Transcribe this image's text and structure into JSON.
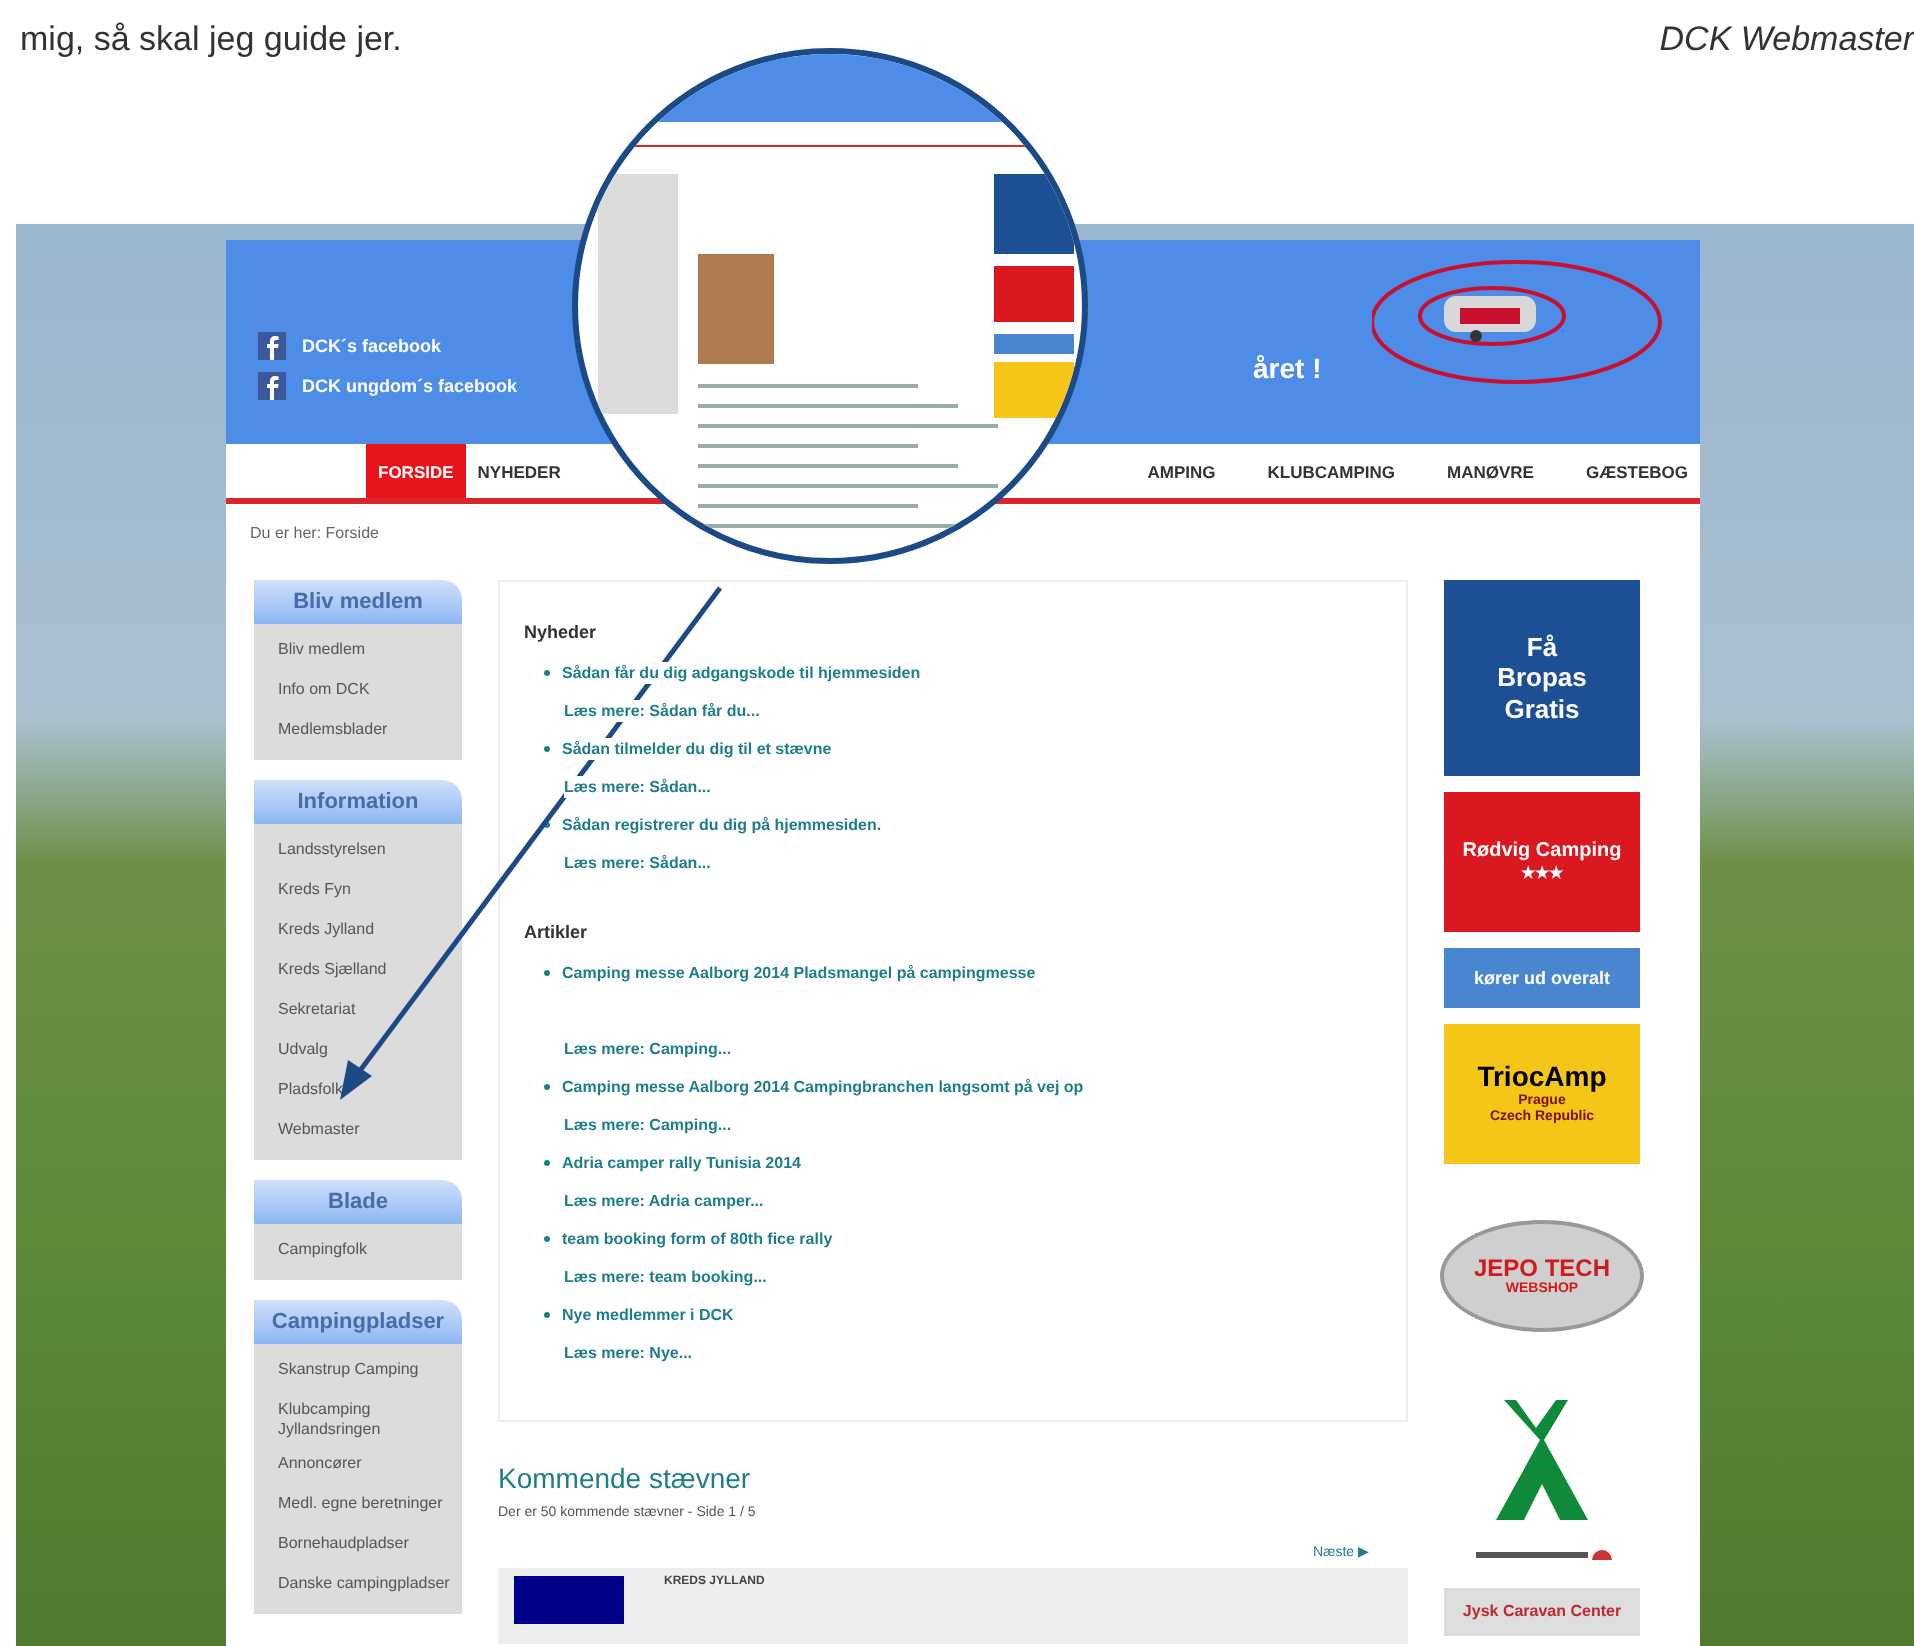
{
  "print_text": {
    "left": "mig, så skal jeg guide jer.",
    "right": "DCK Webmaster"
  },
  "website": {
    "facebook_links": [
      "DCK´s facebook",
      "DCK ungdom´s facebook"
    ],
    "tagline": "året !",
    "nav": [
      {
        "label": "FORSIDE",
        "selected": true
      },
      {
        "label": "NYHEDER",
        "selected": false
      },
      {
        "label": "AMPING",
        "selected": false
      },
      {
        "label": "KLUBCAMPING",
        "selected": false
      },
      {
        "label": "MANØVRE",
        "selected": false
      },
      {
        "label": "GÆSTEBOG",
        "selected": false
      }
    ],
    "breadcrumb": "Du er her: Forside",
    "sidebar": [
      {
        "title": "Bliv medlem",
        "items": [
          "Bliv medlem",
          "Info om DCK",
          "Medlemsblader"
        ]
      },
      {
        "title": "Information",
        "items": [
          "Landsstyrelsen",
          "Kreds Fyn",
          "Kreds Jylland",
          "Kreds Sjælland",
          "Sekretariat",
          "Udvalg",
          "Pladsfolk",
          "Webmaster"
        ]
      },
      {
        "title": "Blade",
        "items": [
          "Campingfolk"
        ]
      },
      {
        "title": "Campingpladser",
        "items": [
          "Skanstrup Camping",
          "Klubcamping Jyllandsringen",
          "Annoncører",
          "Medl. egne beretninger",
          "Bornehaudpladser",
          "Danske campingpladser"
        ]
      }
    ],
    "news": {
      "heading": "Nyheder",
      "items": [
        {
          "title": "Sådan får du dig adgangskode til hjemmesiden",
          "more": "Læs mere: Sådan får du..."
        },
        {
          "title": "Sådan tilmelder du dig til et stævne",
          "more": "Læs mere: Sådan..."
        },
        {
          "title": "Sådan registrerer du dig på hjemmesiden.",
          "more": "Læs mere: Sådan..."
        }
      ]
    },
    "articles": {
      "heading": "Artikler",
      "items": [
        {
          "title": "Camping messe Aalborg 2014 Pladsmangel på campingmesse",
          "more": "Læs mere: Camping..."
        },
        {
          "title": "Camping messe Aalborg 2014 Campingbranchen langsomt på vej op",
          "more": "Læs mere: Camping..."
        },
        {
          "title": "Adria camper rally Tunisia 2014",
          "more": "Læs mere: Adria camper..."
        },
        {
          "title": "team booking form of 80th fice rally",
          "more": "Læs mere: team booking..."
        },
        {
          "title": "Nye medlemmer i DCK",
          "more": "Læs mere: Nye..."
        }
      ]
    },
    "upcoming": {
      "heading": "Kommende stævner",
      "summary": "Der er 50 kommende stævner - Side 1 / 5",
      "next": "Næste ▶",
      "rows": [
        {
          "title": "KREDS JYLLAND"
        }
      ]
    },
    "ads": [
      {
        "kind": "bropas",
        "lines": [
          "Få",
          "Bropas",
          "Gratis"
        ]
      },
      {
        "kind": "rodvig",
        "lines": [
          "Rødvig Camping",
          "★★★"
        ]
      },
      {
        "kind": "banner",
        "lines": [
          "kører ud overalt"
        ]
      },
      {
        "kind": "triocamp",
        "lines": [
          "TriocAmp",
          "Prague",
          "Czech Republic"
        ]
      },
      {
        "kind": "jepo",
        "lines": [
          "JEPO TECH",
          "WEBSHOP"
        ]
      },
      {
        "kind": "tent"
      },
      {
        "kind": "jysk",
        "lines": [
          "Jysk Caravan Center"
        ]
      }
    ]
  }
}
